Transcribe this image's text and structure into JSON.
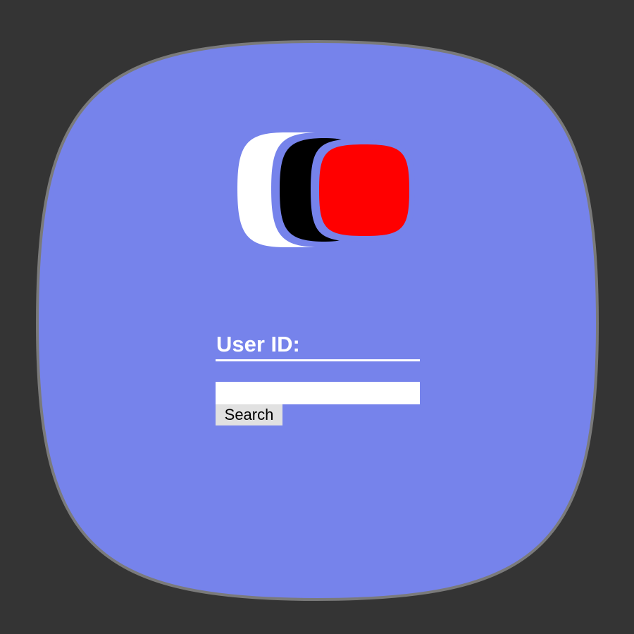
{
  "form": {
    "label": "User ID:",
    "input_value": "",
    "input_placeholder": "",
    "button_label": "Search"
  },
  "colors": {
    "page_background": "#343434",
    "panel_fill": "#7683eb",
    "panel_border": "#7a7a7a",
    "logo_white": "#ffffff",
    "logo_black": "#000000",
    "logo_red": "#ff0000"
  },
  "icons": {
    "logo": "three-overlapping-rounded-squares-logo"
  }
}
